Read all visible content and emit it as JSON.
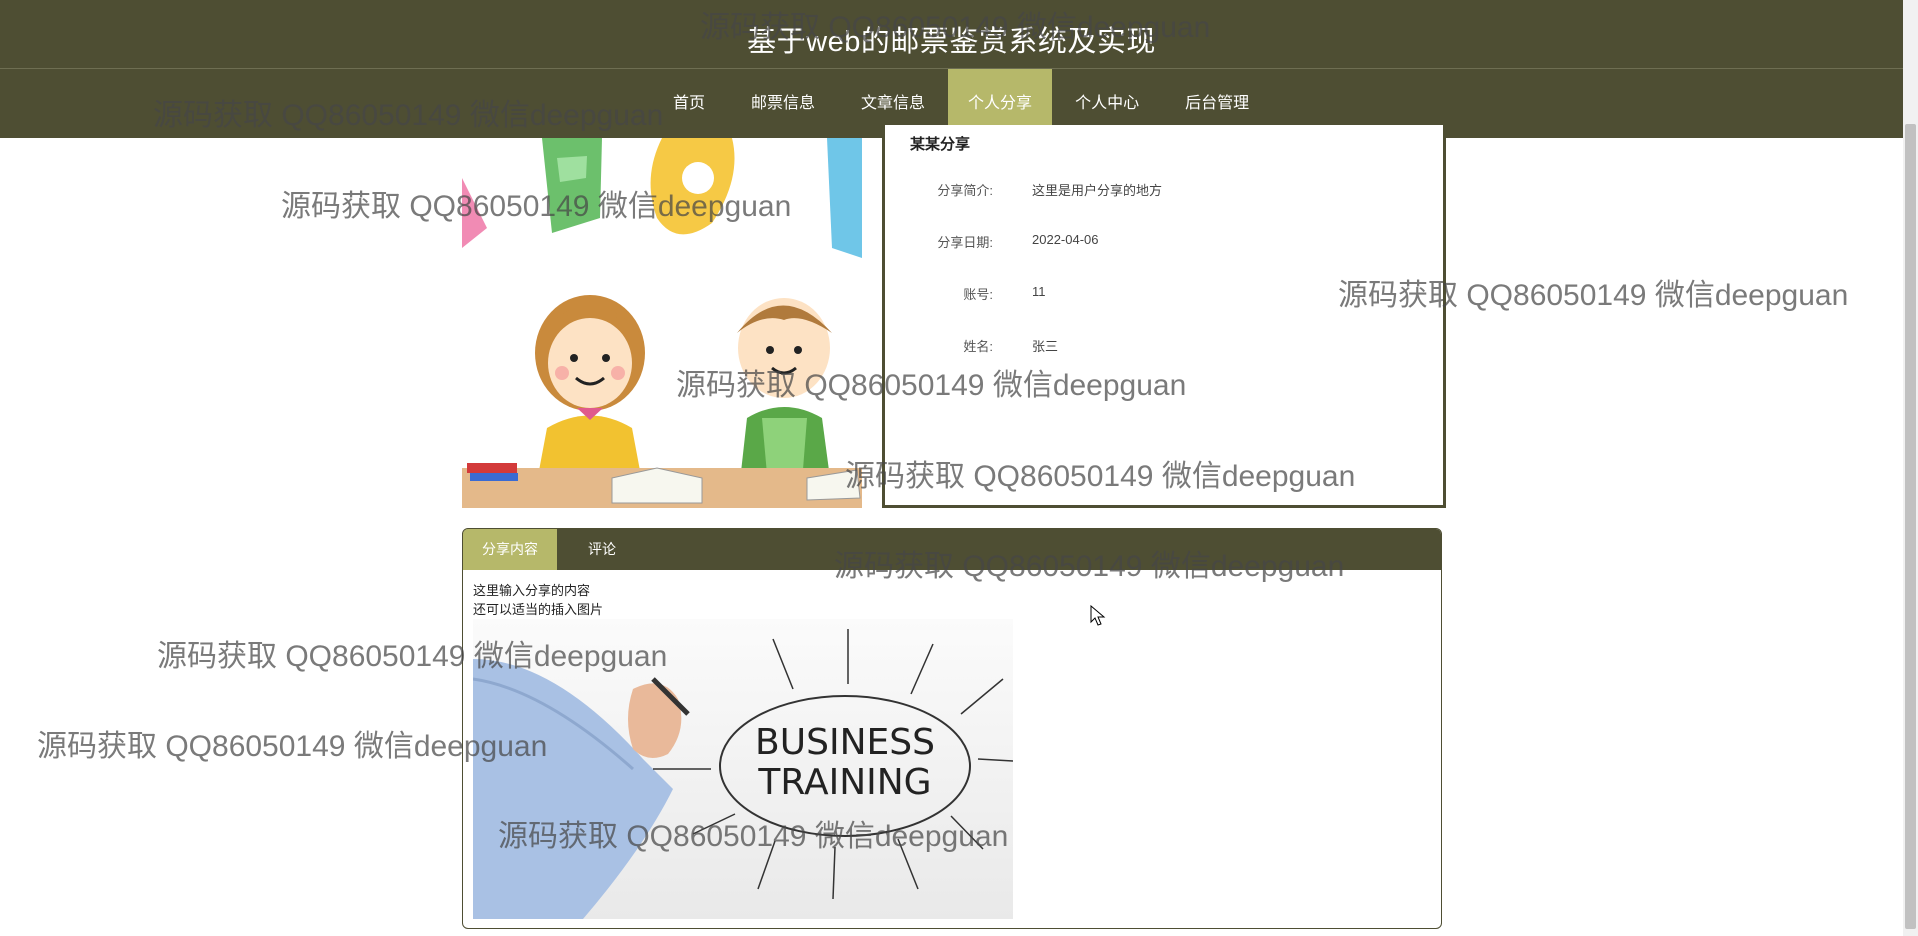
{
  "header": {
    "title": "基于web的邮票鉴赏系统及实现"
  },
  "nav": {
    "items": [
      {
        "label": "首页",
        "active": false
      },
      {
        "label": "邮票信息",
        "active": false
      },
      {
        "label": "文章信息",
        "active": false
      },
      {
        "label": "个人分享",
        "active": true
      },
      {
        "label": "个人中心",
        "active": false
      },
      {
        "label": "后台管理",
        "active": false
      }
    ]
  },
  "detail": {
    "title": "某某分享",
    "fields": [
      {
        "label": "分享简介:",
        "value": "这里是用户分享的地方"
      },
      {
        "label": "分享日期:",
        "value": "2022-04-06"
      },
      {
        "label": "账号:",
        "value": "11"
      },
      {
        "label": "姓名:",
        "value": "张三"
      }
    ]
  },
  "tabs": {
    "items": [
      {
        "label": "分享内容",
        "active": true
      },
      {
        "label": "评论",
        "active": false
      }
    ],
    "content_lines": [
      "这里输入分享的内容",
      "还可以适当的插入图片"
    ]
  },
  "content_image": {
    "line1": "BUSINESS",
    "line2": "TRAINING"
  },
  "watermark": {
    "text": "源码获取 QQ86050149 微信deepguan"
  },
  "colors": {
    "primary": "#4e4e33",
    "accent": "#b6b86a",
    "background": "#ffffff"
  }
}
